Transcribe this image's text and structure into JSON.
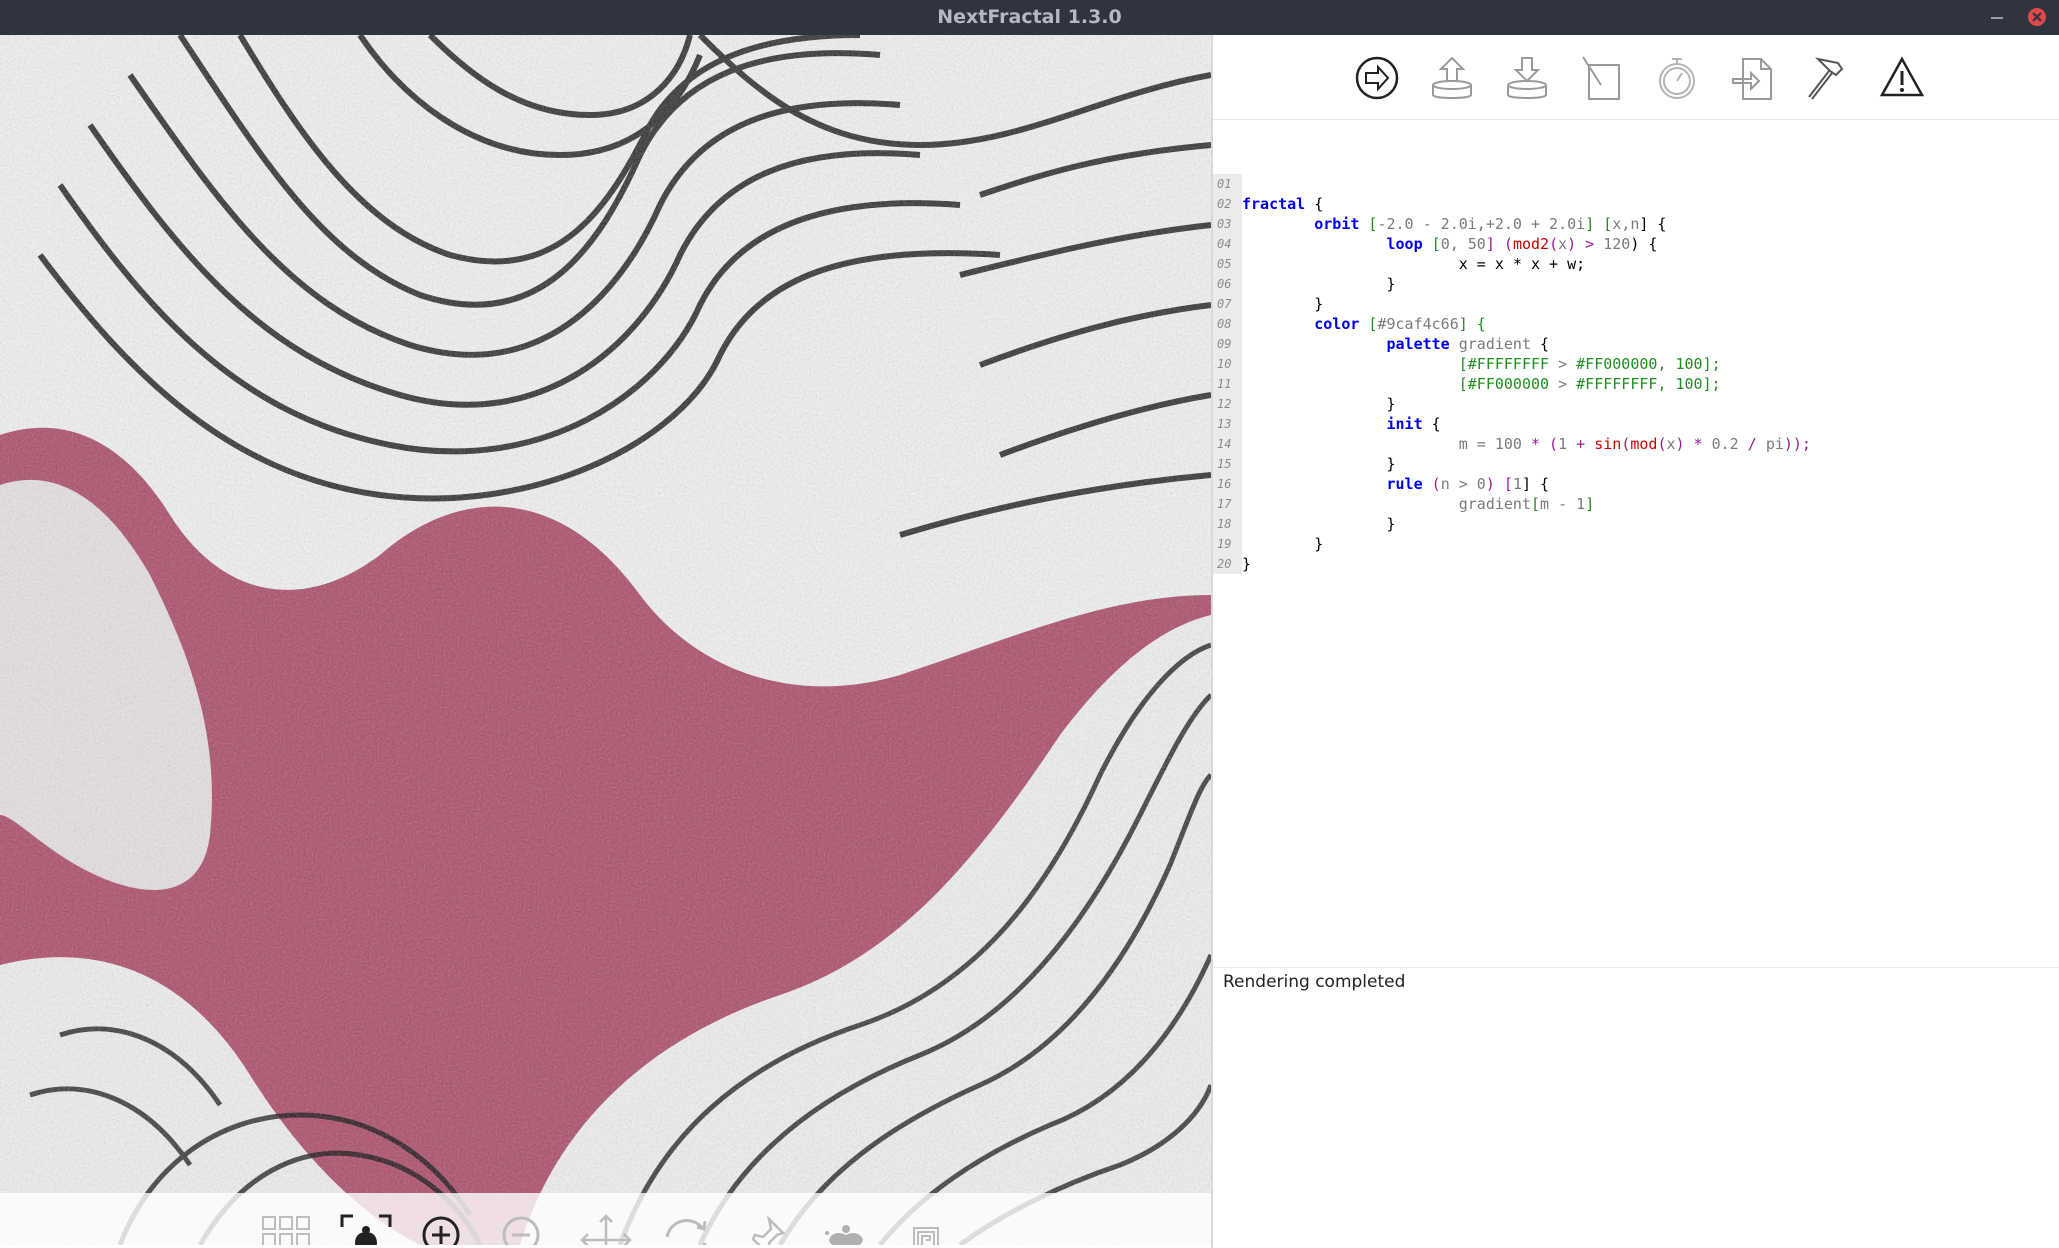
{
  "window": {
    "title": "NextFractal 1.3.0",
    "minimize_icon": "minimize-icon",
    "close_icon": "close-icon",
    "close_color": "#e0484a"
  },
  "fractal": {
    "background_color": "#ac4d68"
  },
  "bottom_toolbar": {
    "tools": [
      "grid-icon",
      "select-region-icon",
      "zoom-in-icon",
      "zoom-out-icon",
      "move-icon",
      "rotate-icon",
      "pin-icon",
      "julia-icon",
      "spiral-icon"
    ]
  },
  "top_toolbar": {
    "tools": [
      "render-icon",
      "upload-icon",
      "download-icon",
      "edit-icon",
      "timer-icon",
      "export-icon",
      "build-icon",
      "warning-icon"
    ]
  },
  "editor": {
    "line_numbers": [
      "01",
      "02",
      "03",
      "04",
      "05",
      "06",
      "07",
      "08",
      "09",
      "10",
      "11",
      "12",
      "13",
      "14",
      "15",
      "16",
      "17",
      "18",
      "19",
      "20"
    ],
    "l01": {
      "kw": "fractal",
      "rest": " {"
    },
    "l02": {
      "kw": "orbit",
      "a": " [",
      "b": "-2.0 - 2.0i,+2.0 + 2.0i",
      "c": "] [",
      "d": "x,n",
      "e": "] {"
    },
    "l03": {
      "kw": "loop",
      "a": " [",
      "b": "0, 50",
      "c": "] (",
      "d": "mod2",
      "e": "(",
      "f": "x",
      "g": ") > ",
      "h": "120",
      "i": ") {"
    },
    "l04": {
      "text": "x = x * x + w;"
    },
    "l05": {
      "text": "}"
    },
    "l06": {
      "text": "}"
    },
    "l07": {
      "kw": "color",
      "a": " [",
      "b": "#9caf4c66",
      "c": "] {"
    },
    "l08": {
      "kw": "palette",
      "a": " ",
      "b": "gradient",
      "c": " {"
    },
    "l09": {
      "a": "[",
      "b": "#FFFFFFFF",
      "c": " > ",
      "d": "#FF000000",
      "e": ", 100];"
    },
    "l10": {
      "a": "[",
      "b": "#FF000000",
      "c": " > ",
      "d": "#FFFFFFFF",
      "e": ", 100];"
    },
    "l11": {
      "text": "}"
    },
    "l12": {
      "kw": "init",
      "rest": " {"
    },
    "l13": {
      "a": "m = ",
      "b": "100",
      "c": " * (",
      "d": "1",
      "e": " + ",
      "f": "sin",
      "g": "(",
      "h": "mod",
      "i": "(",
      "j": "x",
      "k": ") * ",
      "l": "0.2",
      "m": " / ",
      "n": "pi",
      "o": "));"
    },
    "l14": {
      "text": "}"
    },
    "l15": {
      "kw": "rule",
      "a": " (",
      "b": "n > 0",
      "c": ") [",
      "d": "1",
      "e": "] {"
    },
    "l16": {
      "a": "gradient",
      "b": "[",
      "c": "m - 1",
      "d": "]"
    },
    "l17": {
      "text": "}"
    },
    "l18": {
      "text": "}"
    },
    "l19": {
      "text": "}"
    },
    "l20": {
      "text": ""
    }
  },
  "status": {
    "text": "Rendering completed"
  }
}
